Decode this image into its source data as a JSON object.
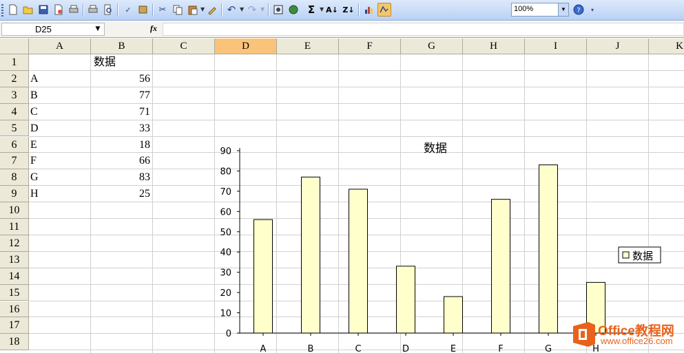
{
  "toolbar": {
    "zoom_value": "100%",
    "icons": [
      "new-icon",
      "open-icon",
      "save-icon",
      "permission-icon",
      "print-icon",
      "print-preview-icon",
      "spelling-icon",
      "research-icon",
      "cut-icon",
      "copy-icon",
      "paste-icon",
      "format-painter-icon",
      "undo-icon",
      "redo-icon",
      "hyperlink-icon",
      "insert-link-icon",
      "autosum-icon",
      "sort-ascending-icon",
      "sort-descending-icon",
      "chart-wizard-icon",
      "drawing-icon",
      "help-icon"
    ]
  },
  "formula_bar": {
    "name_box": "D25",
    "fx_label": "fx",
    "formula": ""
  },
  "sheet": {
    "columns": [
      "A",
      "B",
      "C",
      "D",
      "E",
      "F",
      "G",
      "H",
      "I",
      "J",
      "K"
    ],
    "selected_column": "D",
    "rows": [
      "1",
      "2",
      "3",
      "4",
      "5",
      "6",
      "7",
      "8",
      "9",
      "10",
      "11",
      "12",
      "13",
      "14",
      "15",
      "16",
      "17",
      "18"
    ],
    "cells": {
      "b1": "数据",
      "a_values": [
        "A",
        "B",
        "C",
        "D",
        "E",
        "F",
        "G",
        "H"
      ],
      "b_values": [
        "56",
        "77",
        "71",
        "33",
        "18",
        "66",
        "83",
        "25"
      ]
    }
  },
  "chart_data": {
    "type": "bar",
    "title": "数据",
    "categories": [
      "A",
      "B",
      "C",
      "D",
      "E",
      "F",
      "G",
      "H"
    ],
    "series": [
      {
        "name": "数据",
        "values": [
          56,
          77,
          71,
          33,
          18,
          66,
          83,
          25
        ],
        "color": "#ffffcc"
      }
    ],
    "ylim": [
      0,
      90
    ],
    "yticks": [
      "0",
      "10",
      "20",
      "30",
      "40",
      "50",
      "60",
      "70",
      "80",
      "90"
    ],
    "grid": true,
    "legend": "right"
  },
  "watermark": {
    "line1": "Office教程网",
    "line2": "www.office26.com",
    "color": "#e8621c"
  }
}
